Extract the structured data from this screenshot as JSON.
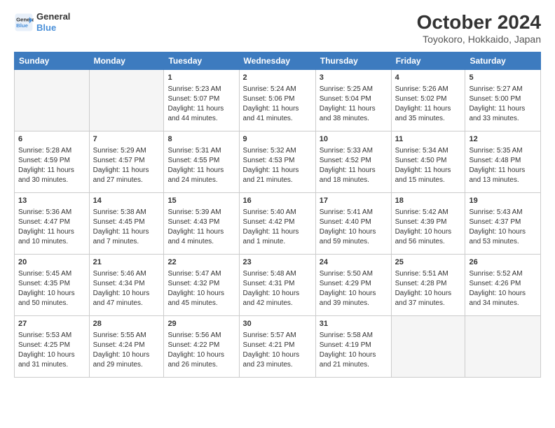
{
  "header": {
    "logo_line1": "General",
    "logo_line2": "Blue",
    "title": "October 2024",
    "subtitle": "Toyokoro, Hokkaido, Japan"
  },
  "weekdays": [
    "Sunday",
    "Monday",
    "Tuesday",
    "Wednesday",
    "Thursday",
    "Friday",
    "Saturday"
  ],
  "weeks": [
    [
      {
        "day": "",
        "info": ""
      },
      {
        "day": "",
        "info": ""
      },
      {
        "day": "1",
        "info": "Sunrise: 5:23 AM\nSunset: 5:07 PM\nDaylight: 11 hours and 44 minutes."
      },
      {
        "day": "2",
        "info": "Sunrise: 5:24 AM\nSunset: 5:06 PM\nDaylight: 11 hours and 41 minutes."
      },
      {
        "day": "3",
        "info": "Sunrise: 5:25 AM\nSunset: 5:04 PM\nDaylight: 11 hours and 38 minutes."
      },
      {
        "day": "4",
        "info": "Sunrise: 5:26 AM\nSunset: 5:02 PM\nDaylight: 11 hours and 35 minutes."
      },
      {
        "day": "5",
        "info": "Sunrise: 5:27 AM\nSunset: 5:00 PM\nDaylight: 11 hours and 33 minutes."
      }
    ],
    [
      {
        "day": "6",
        "info": "Sunrise: 5:28 AM\nSunset: 4:59 PM\nDaylight: 11 hours and 30 minutes."
      },
      {
        "day": "7",
        "info": "Sunrise: 5:29 AM\nSunset: 4:57 PM\nDaylight: 11 hours and 27 minutes."
      },
      {
        "day": "8",
        "info": "Sunrise: 5:31 AM\nSunset: 4:55 PM\nDaylight: 11 hours and 24 minutes."
      },
      {
        "day": "9",
        "info": "Sunrise: 5:32 AM\nSunset: 4:53 PM\nDaylight: 11 hours and 21 minutes."
      },
      {
        "day": "10",
        "info": "Sunrise: 5:33 AM\nSunset: 4:52 PM\nDaylight: 11 hours and 18 minutes."
      },
      {
        "day": "11",
        "info": "Sunrise: 5:34 AM\nSunset: 4:50 PM\nDaylight: 11 hours and 15 minutes."
      },
      {
        "day": "12",
        "info": "Sunrise: 5:35 AM\nSunset: 4:48 PM\nDaylight: 11 hours and 13 minutes."
      }
    ],
    [
      {
        "day": "13",
        "info": "Sunrise: 5:36 AM\nSunset: 4:47 PM\nDaylight: 11 hours and 10 minutes."
      },
      {
        "day": "14",
        "info": "Sunrise: 5:38 AM\nSunset: 4:45 PM\nDaylight: 11 hours and 7 minutes."
      },
      {
        "day": "15",
        "info": "Sunrise: 5:39 AM\nSunset: 4:43 PM\nDaylight: 11 hours and 4 minutes."
      },
      {
        "day": "16",
        "info": "Sunrise: 5:40 AM\nSunset: 4:42 PM\nDaylight: 11 hours and 1 minute."
      },
      {
        "day": "17",
        "info": "Sunrise: 5:41 AM\nSunset: 4:40 PM\nDaylight: 10 hours and 59 minutes."
      },
      {
        "day": "18",
        "info": "Sunrise: 5:42 AM\nSunset: 4:39 PM\nDaylight: 10 hours and 56 minutes."
      },
      {
        "day": "19",
        "info": "Sunrise: 5:43 AM\nSunset: 4:37 PM\nDaylight: 10 hours and 53 minutes."
      }
    ],
    [
      {
        "day": "20",
        "info": "Sunrise: 5:45 AM\nSunset: 4:35 PM\nDaylight: 10 hours and 50 minutes."
      },
      {
        "day": "21",
        "info": "Sunrise: 5:46 AM\nSunset: 4:34 PM\nDaylight: 10 hours and 47 minutes."
      },
      {
        "day": "22",
        "info": "Sunrise: 5:47 AM\nSunset: 4:32 PM\nDaylight: 10 hours and 45 minutes."
      },
      {
        "day": "23",
        "info": "Sunrise: 5:48 AM\nSunset: 4:31 PM\nDaylight: 10 hours and 42 minutes."
      },
      {
        "day": "24",
        "info": "Sunrise: 5:50 AM\nSunset: 4:29 PM\nDaylight: 10 hours and 39 minutes."
      },
      {
        "day": "25",
        "info": "Sunrise: 5:51 AM\nSunset: 4:28 PM\nDaylight: 10 hours and 37 minutes."
      },
      {
        "day": "26",
        "info": "Sunrise: 5:52 AM\nSunset: 4:26 PM\nDaylight: 10 hours and 34 minutes."
      }
    ],
    [
      {
        "day": "27",
        "info": "Sunrise: 5:53 AM\nSunset: 4:25 PM\nDaylight: 10 hours and 31 minutes."
      },
      {
        "day": "28",
        "info": "Sunrise: 5:55 AM\nSunset: 4:24 PM\nDaylight: 10 hours and 29 minutes."
      },
      {
        "day": "29",
        "info": "Sunrise: 5:56 AM\nSunset: 4:22 PM\nDaylight: 10 hours and 26 minutes."
      },
      {
        "day": "30",
        "info": "Sunrise: 5:57 AM\nSunset: 4:21 PM\nDaylight: 10 hours and 23 minutes."
      },
      {
        "day": "31",
        "info": "Sunrise: 5:58 AM\nSunset: 4:19 PM\nDaylight: 10 hours and 21 minutes."
      },
      {
        "day": "",
        "info": ""
      },
      {
        "day": "",
        "info": ""
      }
    ]
  ]
}
